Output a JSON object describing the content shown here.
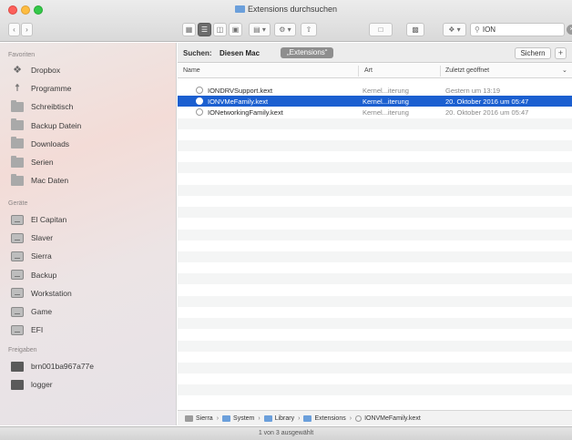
{
  "window": {
    "title": "Extensions durchsuchen"
  },
  "search": {
    "value": "ION"
  },
  "sidebar": {
    "favorites_heading": "Favoriten",
    "favorites": [
      {
        "label": "Dropbox",
        "icon": "dropbox-icon"
      },
      {
        "label": "Programme",
        "icon": "applications-icon"
      },
      {
        "label": "Schreibtisch",
        "icon": "desktop-folder-icon"
      },
      {
        "label": "Backup Datein",
        "icon": "folder-icon"
      },
      {
        "label": "Downloads",
        "icon": "folder-icon"
      },
      {
        "label": "Serien",
        "icon": "folder-icon"
      },
      {
        "label": "Mac Daten",
        "icon": "folder-icon"
      }
    ],
    "devices_heading": "Geräte",
    "devices": [
      {
        "label": "El Capitan",
        "icon": "disk-icon"
      },
      {
        "label": "Slaver",
        "icon": "disk-icon"
      },
      {
        "label": "Sierra",
        "icon": "disk-icon"
      },
      {
        "label": "Backup",
        "icon": "time-machine-disk-icon"
      },
      {
        "label": "Workstation",
        "icon": "disk-icon"
      },
      {
        "label": "Game",
        "icon": "disk-icon"
      },
      {
        "label": "EFI",
        "icon": "disk-icon"
      }
    ],
    "shared_heading": "Freigaben",
    "shared": [
      {
        "label": "brn001ba967a77e",
        "icon": "network-host-icon"
      },
      {
        "label": "logger",
        "icon": "network-host-icon"
      }
    ]
  },
  "scope": {
    "label": "Suchen:",
    "this_mac": "Diesen Mac",
    "folder": "„Extensions“",
    "save": "Sichern",
    "add": "+"
  },
  "columns": {
    "name": "Name",
    "kind": "Art",
    "date": "Zuletzt geöffnet"
  },
  "files": [
    {
      "name": "IONDRVSupport.kext",
      "kind": "Kernel...iterung",
      "date": "Gestern um 13:19",
      "selected": false
    },
    {
      "name": "IONVMeFamily.kext",
      "kind": "Kernel...iterung",
      "date": "20. Oktober 2016 um 05:47",
      "selected": true
    },
    {
      "name": "IONetworkingFamily.kext",
      "kind": "Kernel...iterung",
      "date": "20. Oktober 2016 um 05:47",
      "selected": false
    }
  ],
  "path": [
    "Sierra",
    "System",
    "Library",
    "Extensions",
    "IONVMeFamily.kext"
  ],
  "status": "1 von 3 ausgewählt",
  "colors": {
    "selection": "#1b5fd0",
    "folder_accent": "#6b9fdb"
  }
}
